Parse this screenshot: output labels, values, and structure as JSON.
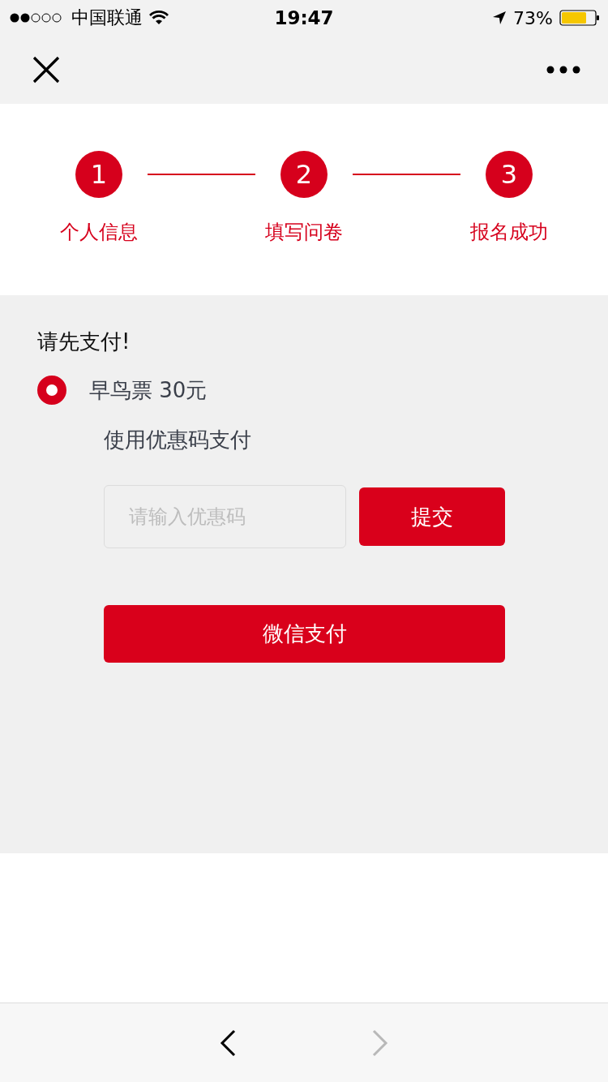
{
  "status_bar": {
    "carrier": "中国联通",
    "time": "19:47",
    "battery": "73%"
  },
  "steps": [
    {
      "number": "1",
      "label": "个人信息"
    },
    {
      "number": "2",
      "label": "填写问卷"
    },
    {
      "number": "3",
      "label": "报名成功"
    }
  ],
  "payment": {
    "prompt": "请先支付!",
    "options": [
      {
        "label": "早鸟票 30元",
        "selected": true
      }
    ],
    "coupon_title": "使用优惠码支付",
    "coupon": {
      "placeholder": "请输入优惠码"
    },
    "submit": "提交",
    "pay": "微信支付"
  },
  "toolbar": {
    "back": {
      "disabled": false
    },
    "forward": {
      "disabled": true
    }
  }
}
